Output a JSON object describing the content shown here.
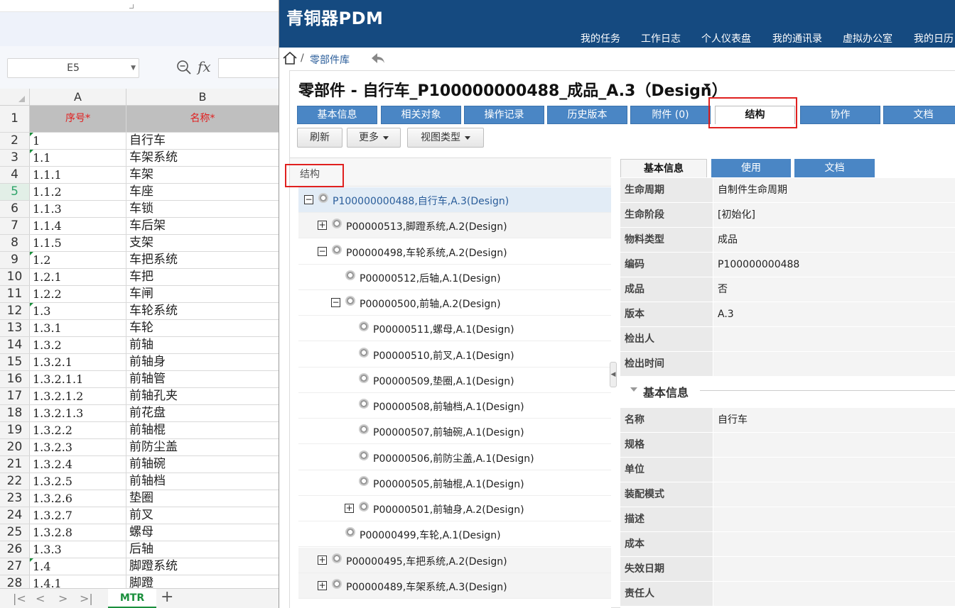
{
  "sheet": {
    "name_box": "E5",
    "col_a": "A",
    "col_b": "B",
    "rows": [
      {
        "n": "1",
        "a": "序号*",
        "b": "名称*"
      },
      {
        "n": "2",
        "a": "1",
        "b": "自行车"
      },
      {
        "n": "3",
        "a": "1.1",
        "b": "车架系统"
      },
      {
        "n": "4",
        "a": "1.1.1",
        "b": "车架"
      },
      {
        "n": "5",
        "a": "1.1.2",
        "b": "车座"
      },
      {
        "n": "6",
        "a": "1.1.3",
        "b": "车锁"
      },
      {
        "n": "7",
        "a": "1.1.4",
        "b": "车后架"
      },
      {
        "n": "8",
        "a": "1.1.5",
        "b": "支架"
      },
      {
        "n": "9",
        "a": "1.2",
        "b": "车把系统"
      },
      {
        "n": "10",
        "a": "1.2.1",
        "b": "车把"
      },
      {
        "n": "11",
        "a": "1.2.2",
        "b": "车闸"
      },
      {
        "n": "12",
        "a": "1.3",
        "b": "车轮系统"
      },
      {
        "n": "13",
        "a": "1.3.1",
        "b": "车轮"
      },
      {
        "n": "14",
        "a": "1.3.2",
        "b": "前轴"
      },
      {
        "n": "15",
        "a": "1.3.2.1",
        "b": "前轴身"
      },
      {
        "n": "16",
        "a": "1.3.2.1.1",
        "b": "前轴管"
      },
      {
        "n": "17",
        "a": "1.3.2.1.2",
        "b": "前轴孔夹"
      },
      {
        "n": "18",
        "a": "1.3.2.1.3",
        "b": "前花盘"
      },
      {
        "n": "19",
        "a": "1.3.2.2",
        "b": "前轴棍"
      },
      {
        "n": "20",
        "a": "1.3.2.3",
        "b": "前防尘盖"
      },
      {
        "n": "21",
        "a": "1.3.2.4",
        "b": "前轴碗"
      },
      {
        "n": "22",
        "a": "1.3.2.5",
        "b": "前轴档"
      },
      {
        "n": "23",
        "a": "1.3.2.6",
        "b": "垫圈"
      },
      {
        "n": "24",
        "a": "1.3.2.7",
        "b": "前叉"
      },
      {
        "n": "25",
        "a": "1.3.2.8",
        "b": "螺母"
      },
      {
        "n": "26",
        "a": "1.3.3",
        "b": "后轴"
      },
      {
        "n": "27",
        "a": "1.4",
        "b": "脚蹬系统"
      },
      {
        "n": "28",
        "a": "1.4.1",
        "b": "脚蹬"
      }
    ],
    "sheet_tab": "MTR",
    "add_label": "+"
  },
  "pdm": {
    "app_title": "青铜器PDM",
    "nav": [
      "我的任务",
      "工作日志",
      "个人仪表盘",
      "我的通讯录",
      "虚拟办公室",
      "我的日历"
    ],
    "breadcrumb_sep": "/",
    "breadcrumb": "零部件库",
    "part_title": "零部件 - 自行车_P100000000488_成品_A.3（Design）",
    "tabs": [
      "基本信息",
      "相关对象",
      "操作记录",
      "历史版本",
      "附件 (0)",
      "结构",
      "协作",
      "文档"
    ],
    "buttons": {
      "refresh": "刷新",
      "more": "更多",
      "view_type": "视图类型"
    },
    "tree_header": "结构",
    "tree": [
      {
        "toggle": "−",
        "label": "P100000000488,自行车,A.3(Design)"
      },
      {
        "toggle": "+",
        "label": "P00000513,脚蹬系统,A.2(Design)"
      },
      {
        "toggle": "−",
        "label": "P00000498,车轮系统,A.2(Design)"
      },
      {
        "toggle": "",
        "label": "P00000512,后轴,A.1(Design)"
      },
      {
        "toggle": "−",
        "label": "P00000500,前轴,A.2(Design)"
      },
      {
        "toggle": "",
        "label": "P00000511,螺母,A.1(Design)"
      },
      {
        "toggle": "",
        "label": "P00000510,前叉,A.1(Design)"
      },
      {
        "toggle": "",
        "label": "P00000509,垫圈,A.1(Design)"
      },
      {
        "toggle": "",
        "label": "P00000508,前轴档,A.1(Design)"
      },
      {
        "toggle": "",
        "label": "P00000507,前轴碗,A.1(Design)"
      },
      {
        "toggle": "",
        "label": "P00000506,前防尘盖,A.1(Design)"
      },
      {
        "toggle": "",
        "label": "P00000505,前轴棍,A.1(Design)"
      },
      {
        "toggle": "+",
        "label": "P00000501,前轴身,A.2(Design)"
      },
      {
        "toggle": "",
        "label": "P00000499,车轮,A.1(Design)"
      },
      {
        "toggle": "+",
        "label": "P00000495,车把系统,A.2(Design)"
      },
      {
        "toggle": "+",
        "label": "P00000489,车架系统,A.3(Design)"
      }
    ],
    "detail_tabs": [
      "基本信息",
      "使用",
      "文档"
    ],
    "props": [
      {
        "k": "生命周期",
        "v": "自制件生命周期"
      },
      {
        "k": "生命阶段",
        "v": "[初始化]"
      },
      {
        "k": "物料类型",
        "v": "成品"
      },
      {
        "k": "编码",
        "v": "P100000000488"
      },
      {
        "k": "成品",
        "v": "否"
      },
      {
        "k": "版本",
        "v": "A.3"
      },
      {
        "k": "检出人",
        "v": ""
      },
      {
        "k": "检出时间",
        "v": ""
      }
    ],
    "section_title": "基本信息",
    "basic": [
      {
        "k": "名称",
        "v": "自行车"
      },
      {
        "k": "规格",
        "v": ""
      },
      {
        "k": "单位",
        "v": ""
      },
      {
        "k": "装配模式",
        "v": ""
      },
      {
        "k": "描述",
        "v": ""
      },
      {
        "k": "成本",
        "v": ""
      },
      {
        "k": "失效日期",
        "v": ""
      },
      {
        "k": "责任人",
        "v": ""
      }
    ]
  }
}
